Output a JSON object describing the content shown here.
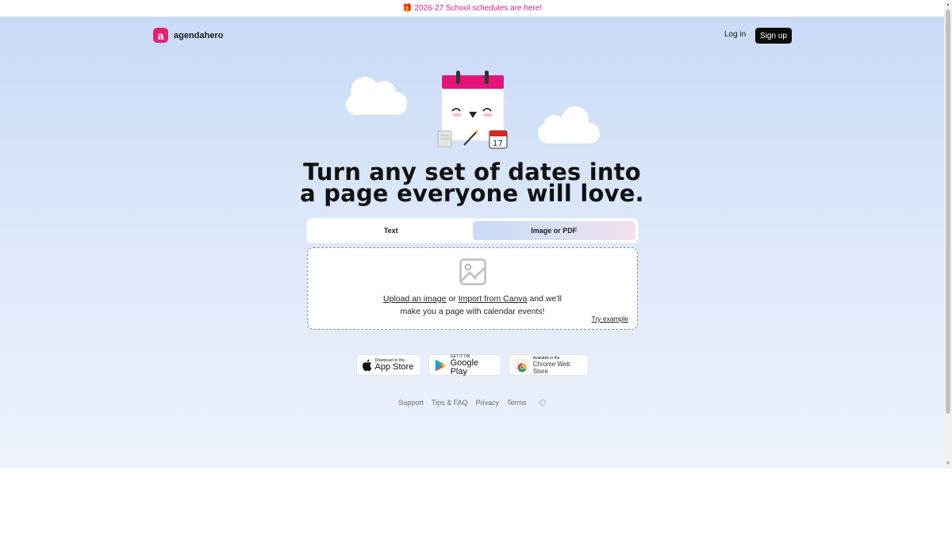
{
  "banner": {
    "icon": "gift-icon",
    "text": "2026-27 School schedules are here!",
    "color": "#d61f86"
  },
  "header": {
    "logo_letter": "a",
    "logo_text": "agendahero",
    "brand_color": "#e0246f",
    "login_label": "Log in",
    "signup_label": "Sign up"
  },
  "hero": {
    "headline_line1": "Turn any set of dates into",
    "headline_line2": "a page everyone will love.",
    "mascot_calendar_date": "17"
  },
  "tabs": [
    {
      "label": "Text",
      "active": false
    },
    {
      "label": "Image or PDF",
      "active": true
    }
  ],
  "dropzone": {
    "icon": "image-placeholder-icon",
    "upload_link": "Upload an image",
    "or_text": " or ",
    "canva_link": "Import from Canva",
    "rest_line1": " and we'll",
    "line2": "make you a page with calendar events!",
    "try_example": "Try example"
  },
  "badges": {
    "appstore": {
      "small": "Download on the",
      "big": "App Store"
    },
    "googleplay": {
      "small": "GET IT ON",
      "big": "Google Play"
    },
    "chrome": {
      "small": "Available in the",
      "big": "Chrome Web Store"
    }
  },
  "footer": {
    "links": [
      "Support",
      "Tips & FAQ",
      "Privacy",
      "Terms"
    ]
  }
}
